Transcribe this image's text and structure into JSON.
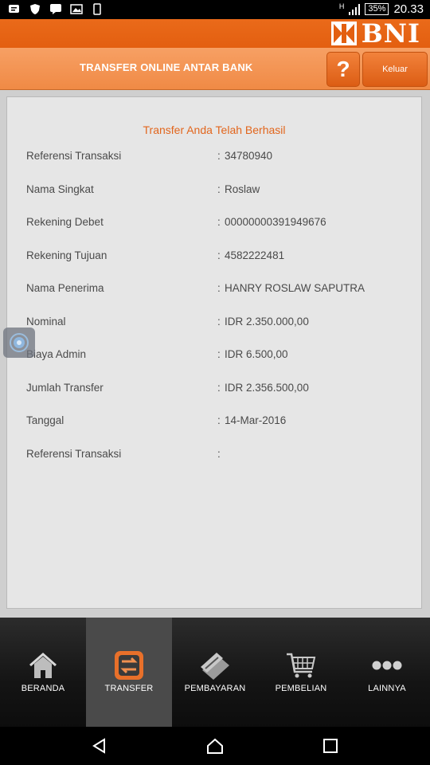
{
  "status_bar": {
    "battery": "35%",
    "time": "20.33",
    "network": "H"
  },
  "brand": {
    "name": "BNI"
  },
  "header": {
    "title": "TRANSFER ONLINE ANTAR BANK",
    "help_label": "?",
    "logout_label": "Keluar"
  },
  "receipt": {
    "message": "Transfer Anda Telah Berhasil",
    "separator": ":",
    "rows": [
      {
        "label": "Referensi Transaksi",
        "value": "34780940"
      },
      {
        "label": "Nama Singkat",
        "value": "Roslaw"
      },
      {
        "label": "Rekening Debet",
        "value": "00000000391949676"
      },
      {
        "label": "Rekening Tujuan",
        "value": "4582222481"
      },
      {
        "label": "Nama Penerima",
        "value": "HANRY ROSLAW SAPUTRA"
      },
      {
        "label": "Nominal",
        "value": "IDR 2.350.000,00"
      },
      {
        "label": "Biaya Admin",
        "value": "IDR 6.500,00"
      },
      {
        "label": "Jumlah Transfer",
        "value": "IDR 2.356.500,00"
      },
      {
        "label": "Tanggal",
        "value": "14-Mar-2016"
      },
      {
        "label": "Referensi Transaksi",
        "value": ""
      }
    ]
  },
  "bottom_nav": {
    "items": [
      {
        "label": "BERANDA",
        "icon": "home-icon"
      },
      {
        "label": "TRANSFER",
        "icon": "transfer-icon",
        "active": true
      },
      {
        "label": "PEMBAYARAN",
        "icon": "card-icon"
      },
      {
        "label": "PEMBELIAN",
        "icon": "cart-icon"
      },
      {
        "label": "LAINNYA",
        "icon": "more-icon"
      }
    ]
  },
  "colors": {
    "accent": "#e35f10",
    "accent_light": "#f08a45",
    "success_text": "#e2661d"
  }
}
